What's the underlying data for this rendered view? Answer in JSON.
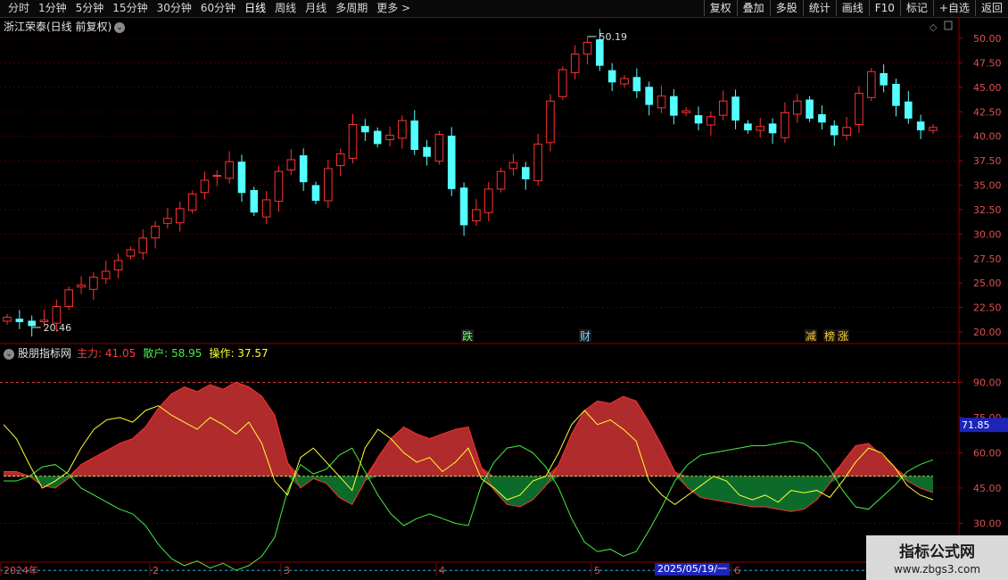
{
  "toolbar": {
    "periods": [
      "分时",
      "1分钟",
      "5分钟",
      "15分钟",
      "30分钟",
      "60分钟",
      "日线",
      "周线",
      "月线",
      "多周期",
      "更多 >"
    ],
    "active_period": "日线",
    "right_buttons": [
      "复权",
      "叠加",
      "多股",
      "统计",
      "画线",
      "F10",
      "标记",
      "+自选",
      "返回"
    ]
  },
  "main": {
    "title": "浙江荣泰(日线 前复权)",
    "high_label": "50.19",
    "low_label": "20.46",
    "markers": [
      {
        "text": "跌",
        "color": "#6cff6c"
      },
      {
        "text": "财",
        "color": "#7fd6ff"
      },
      {
        "text": "减",
        "color": "#ffcc33"
      },
      {
        "text": "榜",
        "color": "#ffcc33"
      },
      {
        "text": "涨",
        "color": "#ffcc33"
      }
    ],
    "price_ticks": [
      "50.00",
      "47.50",
      "45.00",
      "42.50",
      "40.00",
      "37.50",
      "35.00",
      "32.50",
      "30.00",
      "27.50",
      "25.00",
      "22.50",
      "20.00"
    ]
  },
  "indicator": {
    "name": "股朋指标网",
    "zhuli": "主力: 41.05",
    "sanhu": "散户: 58.95",
    "caozuo": "操作: 37.57",
    "ticks": [
      "90.00",
      "75.00",
      "60.00",
      "45.00",
      "30.00"
    ],
    "current_value": "71.85"
  },
  "time_axis": {
    "labels": [
      "2024年",
      "2",
      "3",
      "4",
      "5",
      "6"
    ],
    "cursor_date": "2025/05/19/一"
  },
  "watermark": {
    "line1": "指标公式网",
    "line2": "www.zbgs3.com"
  },
  "colors": {
    "up": "#ff3232",
    "down": "#54ffff",
    "grid": "#7a0000",
    "zhuli_fill": "#b02b2b",
    "sanhu_fill": "#0c6b2a",
    "sanhu_line": "#44ee44",
    "caozuo_line": "#ffff33"
  },
  "chart_data": {
    "type": "candlestick",
    "ylim": [
      20.0,
      50.19
    ],
    "close_path": [
      21.5,
      21.0,
      20.6,
      21.2,
      22.6,
      24.3,
      24.8,
      25.6,
      26.2,
      27.3,
      28.4,
      29.6,
      30.8,
      31.6,
      32.6,
      34.1,
      35.5,
      36.0,
      37.4,
      34.2,
      32.2,
      33.5,
      36.4,
      37.6,
      35.3,
      33.4,
      36.7,
      38.2,
      41.2,
      40.4,
      39.2,
      40.1,
      41.6,
      38.6,
      37.9,
      40.2,
      34.6,
      30.9,
      32.5,
      34.6,
      36.4,
      37.3,
      35.6,
      39.2,
      43.6,
      46.8,
      48.4,
      49.6,
      47.2,
      45.5,
      45.9,
      44.6,
      43.2,
      44.1,
      42.1,
      42.6,
      41.3,
      42.0,
      43.6,
      41.6,
      40.6,
      41.0,
      40.3,
      42.4,
      43.6,
      41.8,
      41.4,
      40.1,
      40.9,
      44.4,
      46.6,
      45.2,
      43.1,
      41.8,
      40.6,
      40.9
    ],
    "indicator_ylim": [
      15,
      100
    ],
    "zhuli_path": [
      52,
      52,
      50,
      46,
      45,
      49,
      55,
      58,
      61,
      64,
      66,
      71,
      79,
      85,
      88,
      86,
      89,
      87,
      90,
      88,
      84,
      76,
      56,
      45,
      49,
      47,
      41,
      38,
      48,
      58,
      66,
      71,
      68,
      66,
      68,
      70,
      71,
      54,
      44,
      38,
      37,
      40,
      46,
      55,
      68,
      78,
      82,
      81,
      84,
      82,
      73,
      63,
      52,
      45,
      41,
      40,
      39,
      38,
      37,
      37,
      36,
      35,
      36,
      40,
      47,
      56,
      63,
      64,
      59,
      54,
      48,
      45,
      43
    ],
    "sanhu_path": [
      48,
      48,
      50,
      54,
      55,
      51,
      45,
      42,
      39,
      36,
      34,
      29,
      21,
      15,
      12,
      14,
      11,
      13,
      10,
      12,
      16,
      24,
      44,
      55,
      51,
      53,
      59,
      62,
      52,
      42,
      34,
      29,
      32,
      34,
      32,
      30,
      29,
      46,
      56,
      62,
      63,
      60,
      54,
      45,
      32,
      22,
      18,
      19,
      16,
      18,
      27,
      37,
      48,
      55,
      59,
      60,
      61,
      62,
      63,
      63,
      64,
      65,
      64,
      60,
      53,
      44,
      37,
      36,
      41,
      46,
      52,
      55,
      57
    ],
    "caozuo_path": [
      72,
      66,
      55,
      45,
      48,
      52,
      62,
      70,
      74,
      75,
      73,
      78,
      80,
      76,
      73,
      70,
      75,
      72,
      68,
      73,
      64,
      48,
      42,
      58,
      62,
      56,
      50,
      44,
      62,
      70,
      66,
      60,
      56,
      58,
      52,
      56,
      62,
      49,
      45,
      40,
      42,
      48,
      50,
      60,
      72,
      78,
      72,
      74,
      70,
      65,
      48,
      42,
      38,
      42,
      46,
      50,
      48,
      42,
      40,
      42,
      39,
      44,
      43,
      44,
      41,
      48,
      56,
      62,
      60,
      54,
      46,
      42,
      40
    ]
  }
}
